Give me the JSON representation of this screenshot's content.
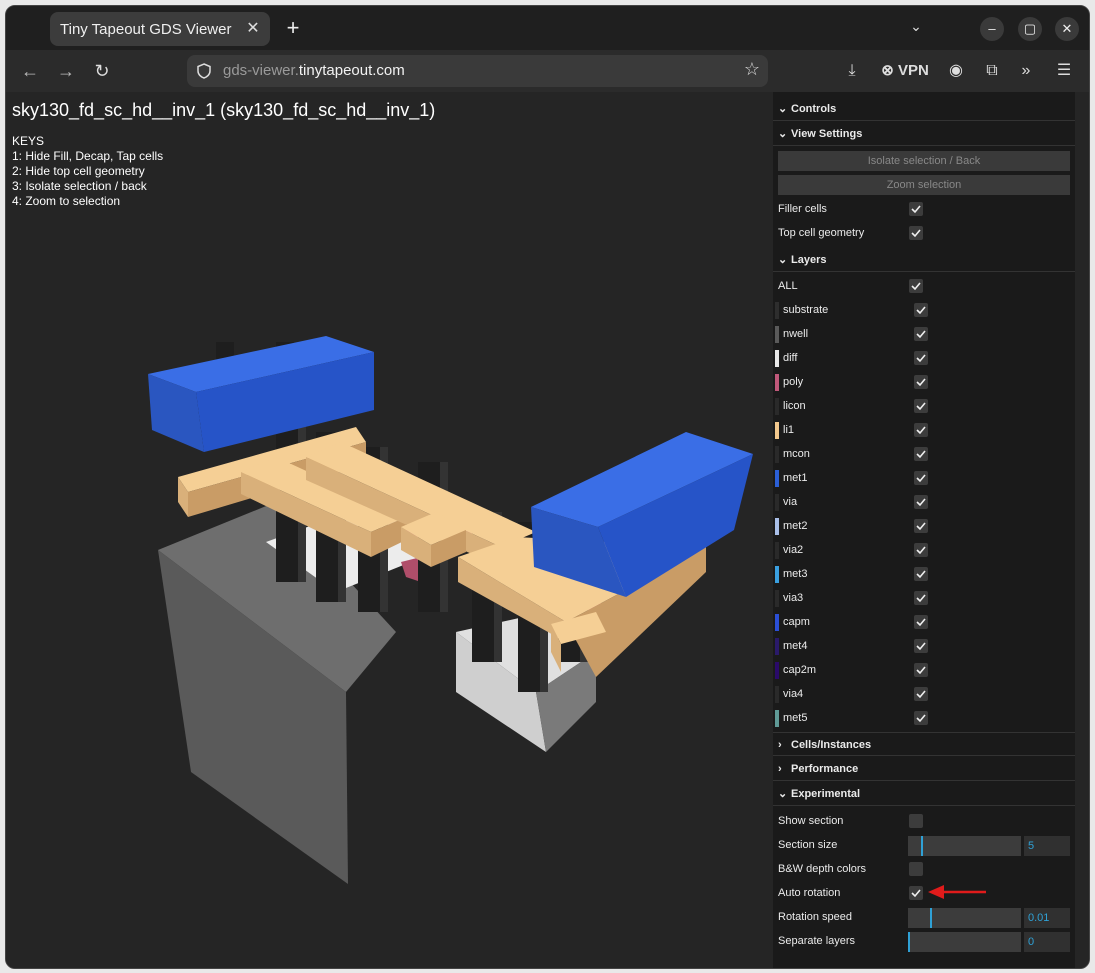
{
  "browser": {
    "tab_title": "Tiny Tapeout GDS Viewer",
    "url_host_prefix": "gds-viewer.",
    "url_host_domain": "tinytapeout.com",
    "vpn_label": "VPN"
  },
  "page": {
    "title": "sky130_fd_sc_hd__inv_1 (sky130_fd_sc_hd__inv_1)",
    "keys_header": "KEYS",
    "keys": [
      "1: Hide Fill, Decap, Tap cells",
      "2: Hide top cell geometry",
      "3: Isolate selection / back",
      "4: Zoom to selection"
    ]
  },
  "panel": {
    "controls": "Controls",
    "view_settings": "View Settings",
    "isolate_btn": "Isolate selection / Back",
    "zoom_btn": "Zoom selection",
    "filler_cells": "Filler cells",
    "top_cell_geometry": "Top cell geometry",
    "layers_header": "Layers",
    "all_label": "ALL",
    "layers": [
      {
        "name": "substrate",
        "color": "#2e2e2e"
      },
      {
        "name": "nwell",
        "color": "#5a5a5a"
      },
      {
        "name": "diff",
        "color": "#e8e8e8"
      },
      {
        "name": "poly",
        "color": "#c0587a"
      },
      {
        "name": "licon",
        "color": "#2a2a2a"
      },
      {
        "name": "li1",
        "color": "#f2c88d"
      },
      {
        "name": "mcon",
        "color": "#2a2a2a"
      },
      {
        "name": "met1",
        "color": "#2b5fd6"
      },
      {
        "name": "via",
        "color": "#2a2a2a"
      },
      {
        "name": "met2",
        "color": "#a9bfe8"
      },
      {
        "name": "via2",
        "color": "#2a2a2a"
      },
      {
        "name": "met3",
        "color": "#3aa0e0"
      },
      {
        "name": "via3",
        "color": "#2a2a2a"
      },
      {
        "name": "capm",
        "color": "#2b4fd6"
      },
      {
        "name": "met4",
        "color": "#2a1a6a"
      },
      {
        "name": "cap2m",
        "color": "#2a0a6a"
      },
      {
        "name": "via4",
        "color": "#2a2a2a"
      },
      {
        "name": "met5",
        "color": "#5f9a96"
      }
    ],
    "cells_instances": "Cells/Instances",
    "performance": "Performance",
    "experimental": "Experimental",
    "show_section": "Show section",
    "section_size": "Section size",
    "section_size_value": "5",
    "bw_depth": "B&W depth colors",
    "auto_rotation": "Auto rotation",
    "rotation_speed": "Rotation speed",
    "rotation_speed_value": "0.01",
    "separate_layers": "Separate layers",
    "separate_layers_value": "0"
  }
}
